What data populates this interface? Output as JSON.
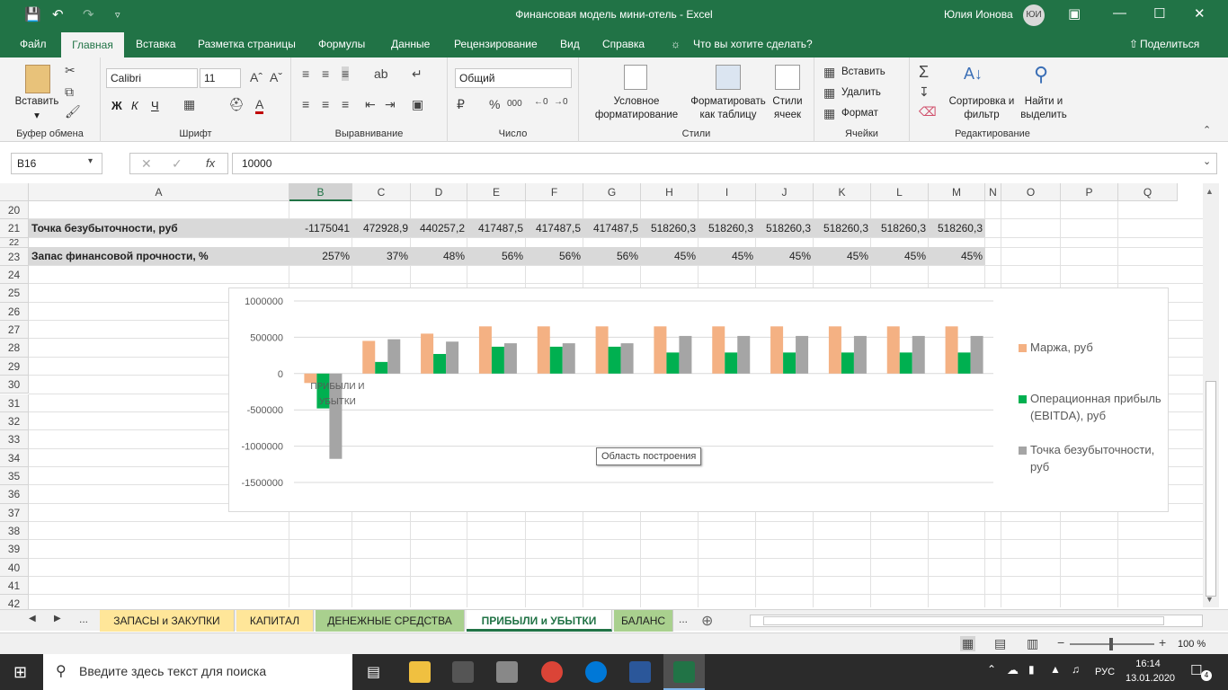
{
  "titlebar": {
    "title": "Финансовая модель мини-отель  -  Excel",
    "user": "Юлия Ионова",
    "initials": "ЮИ"
  },
  "menu": [
    "Файл",
    "Главная",
    "Вставка",
    "Разметка страницы",
    "Формулы",
    "Данные",
    "Рецензирование",
    "Вид",
    "Справка",
    "Что вы хотите сделать?",
    "Поделиться"
  ],
  "ribbon": {
    "paste": "Вставить",
    "clipboard": "Буфер обмена",
    "font_name": "Calibri",
    "font_size": "11",
    "font_group": "Шрифт",
    "align_group": "Выравнивание",
    "number_format": "Общий",
    "number_group": "Число",
    "cond_format": "Условное форматирование",
    "format_table": "Форматировать как таблицу",
    "cell_styles": "Стили ячеек",
    "styles_group": "Стили",
    "insert": "Вставить",
    "delete": "Удалить",
    "format": "Формат",
    "cells_group": "Ячейки",
    "sort": "Сортировка и фильтр",
    "find": "Найти и выделить",
    "edit_group": "Редактирование",
    "bold": "Ж",
    "italic": "К",
    "underline": "Ч"
  },
  "formula": {
    "namebox": "B16",
    "value": "10000",
    "fx": "fx"
  },
  "columns": [
    "A",
    "B",
    "C",
    "D",
    "E",
    "F",
    "G",
    "H",
    "I",
    "J",
    "K",
    "L",
    "M",
    "N",
    "O",
    "P",
    "Q"
  ],
  "rows": [
    "20",
    "21",
    "22",
    "23",
    "24",
    "25",
    "26",
    "27",
    "28",
    "29",
    "30",
    "31",
    "32",
    "33",
    "34",
    "35",
    "36",
    "37",
    "38",
    "39",
    "40",
    "41",
    "42"
  ],
  "row21": {
    "label": "Точка безубыточности, руб",
    "values": [
      "-1175041",
      "472928,9",
      "440257,2",
      "417487,5",
      "417487,5",
      "417487,5",
      "518260,3",
      "518260,3",
      "518260,3",
      "518260,3",
      "518260,3",
      "518260,3"
    ]
  },
  "row23": {
    "label": "Запас финансовой прочности, %",
    "values": [
      "257%",
      "37%",
      "48%",
      "56%",
      "56%",
      "56%",
      "45%",
      "45%",
      "45%",
      "45%",
      "45%",
      "45%"
    ]
  },
  "chart_data": {
    "type": "bar",
    "categories": [
      "ПРИБЫЛИ И УБЫТКИ",
      "",
      "",
      "",
      "",
      "",
      "",
      "",
      "",
      "",
      "",
      ""
    ],
    "series": [
      {
        "name": "Маржа, руб",
        "color": "#f4b183",
        "values": [
          -130000,
          450000,
          550000,
          650000,
          650000,
          650000,
          650000,
          650000,
          650000,
          650000,
          650000,
          650000
        ]
      },
      {
        "name": "Операционная прибыль (EBITDA), руб",
        "color": "#00b050",
        "values": [
          -480000,
          160000,
          270000,
          370000,
          370000,
          370000,
          290000,
          290000,
          290000,
          290000,
          290000,
          290000
        ]
      },
      {
        "name": "Точка безубыточности, руб",
        "color": "#a5a5a5",
        "values": [
          -1175041,
          472928.9,
          440257.2,
          417487.5,
          417487.5,
          417487.5,
          518260.3,
          518260.3,
          518260.3,
          518260.3,
          518260.3,
          518260.3
        ]
      }
    ],
    "yticks": [
      "1000000",
      "500000",
      "0",
      "-500000",
      "-1000000",
      "-1500000"
    ],
    "ylim": [
      -1500000,
      1000000
    ],
    "legend": "right",
    "tooltip": "Область построения"
  },
  "sheets": [
    "ЗАПАСЫ и ЗАКУПКИ",
    "КАПИТАЛ",
    "ДЕНЕЖНЫЕ СРЕДСТВА",
    "ПРИБЫЛИ и УБЫТКИ",
    "БАЛАНС"
  ],
  "sheet_ellipsis": "...",
  "zoom": "100 %",
  "taskbar": {
    "search": "Введите здесь текст для поиска",
    "lang": "РУС",
    "time": "16:14",
    "date": "13.01.2020",
    "notif": "4"
  }
}
